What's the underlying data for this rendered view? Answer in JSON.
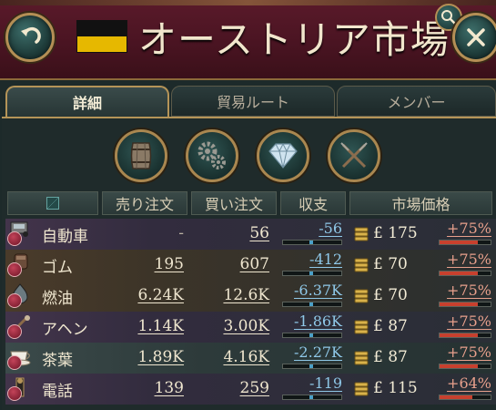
{
  "header": {
    "title": "オーストリア市場",
    "flag_colors": [
      "#111111",
      "#e6b800"
    ]
  },
  "tabs": [
    {
      "label": "詳細",
      "active": true
    },
    {
      "label": "貿易ルート",
      "active": false
    },
    {
      "label": "メンバー",
      "active": false
    }
  ],
  "category_icons": [
    "barrel-icon",
    "gears-icon",
    "diamond-icon",
    "crossed-rifles-icon"
  ],
  "columns": {
    "sell": "売り注文",
    "buy": "買い注文",
    "balance": "収支",
    "price": "市場価格"
  },
  "goods": [
    {
      "name": "自動車",
      "icon": "car-icon",
      "sell": "-",
      "buy": "56",
      "balance": "-56",
      "balance_level": 0.5,
      "price": "£ 175",
      "pct": "+75%",
      "pct_level": 0.75
    },
    {
      "name": "ゴム",
      "icon": "rubber-icon",
      "sell": "195",
      "buy": "607",
      "balance": "-412",
      "balance_level": 0.5,
      "price": "£ 70",
      "pct": "+75%",
      "pct_level": 0.75
    },
    {
      "name": "燃油",
      "icon": "oil-icon",
      "sell": "6.24K",
      "buy": "12.6K",
      "balance": "-6.37K",
      "balance_level": 0.5,
      "price": "£ 70",
      "pct": "+75%",
      "pct_level": 0.75
    },
    {
      "name": "アヘン",
      "icon": "opium-icon",
      "sell": "1.14K",
      "buy": "3.00K",
      "balance": "-1.86K",
      "balance_level": 0.5,
      "price": "£ 87",
      "pct": "+75%",
      "pct_level": 0.75
    },
    {
      "name": "茶葉",
      "icon": "tea-icon",
      "sell": "1.89K",
      "buy": "4.16K",
      "balance": "-2.27K",
      "balance_level": 0.5,
      "price": "£ 87",
      "pct": "+75%",
      "pct_level": 0.75
    },
    {
      "name": "電話",
      "icon": "telephone-icon",
      "sell": "139",
      "buy": "259",
      "balance": "-119",
      "balance_level": 0.5,
      "price": "£ 115",
      "pct": "+64%",
      "pct_level": 0.64
    }
  ]
}
